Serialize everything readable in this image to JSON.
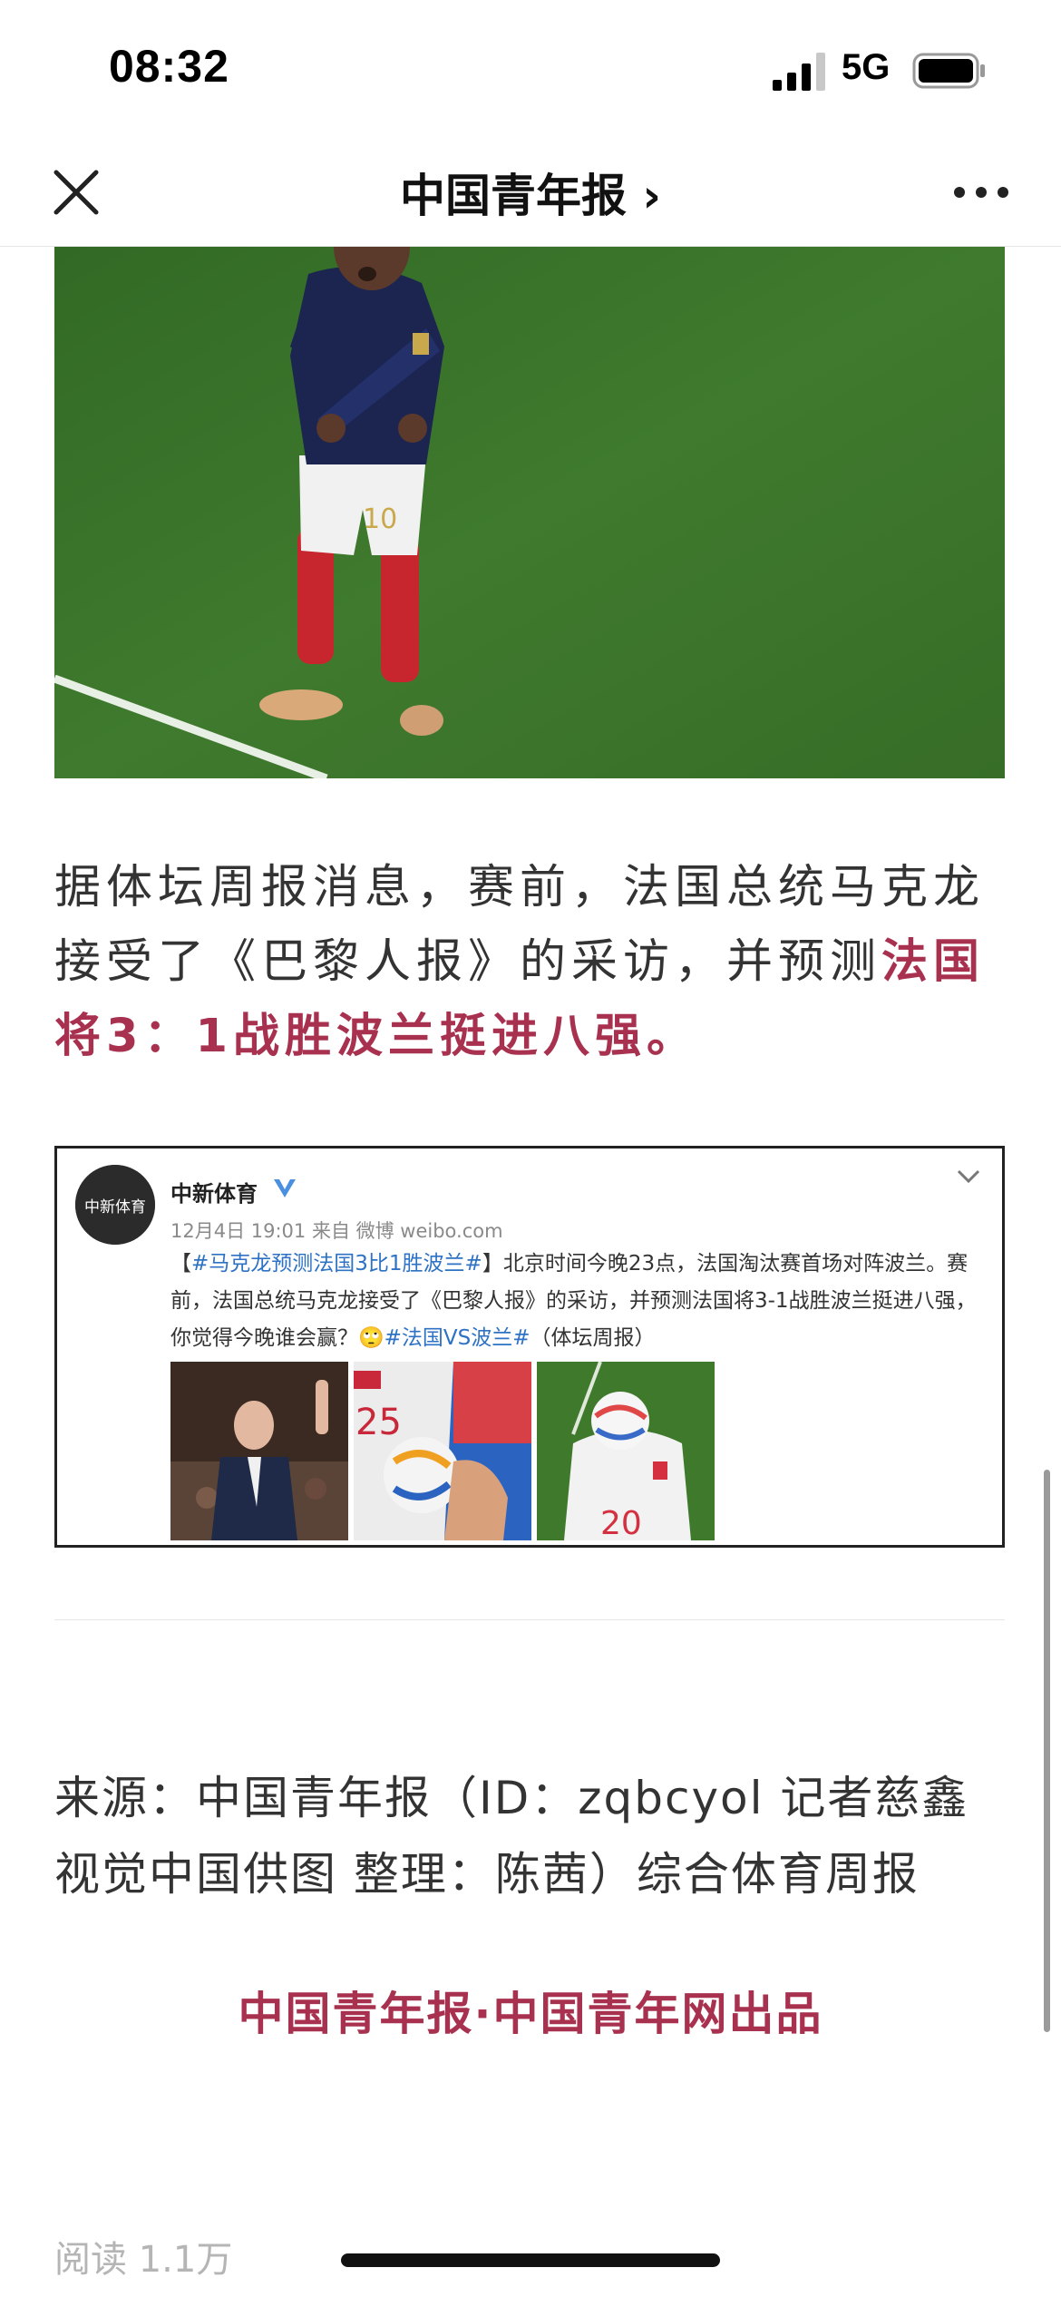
{
  "status_bar": {
    "time": "08:32",
    "network": "5G"
  },
  "nav": {
    "title": "中国青年报 ›"
  },
  "article": {
    "paragraph_plain": "据体坛周报消息，赛前，法国总统马克龙接受了《巴黎人报》的采访，并预测",
    "paragraph_highlight": "法国将3：1战胜波兰挺进八强。",
    "embed": {
      "account_name": "中新体育",
      "avatar_text": "中新体育",
      "meta": "12月4日 19:01 来自 微博 weibo.com",
      "text_bracket_open": "【",
      "text_tag1": "#马克龙预测法国3比1胜波兰#",
      "text_body": "】北京时间今晚23点，法国淘汰赛首场对阵波兰。赛前，法国总统马克龙接受了《巴黎人报》的采访，并预测法国将3-1战胜波兰挺进八强，你觉得今晚谁会赢？🙄",
      "text_tag2": "#法国VS波兰#",
      "text_suffix": "（体坛周报）",
      "photo2_number": "25",
      "photo3_number": "20"
    },
    "source": "来源：中国青年报（ID：zqbcyol 记者慈鑫 视觉中国供图 整理：陈茜）综合体育周报",
    "brand_line": "中国青年报·中国青年网出品",
    "read_count": "阅读 1.1万"
  },
  "colors": {
    "accent": "#a8314f",
    "link": "#2d72c4",
    "pitch": "#3f7d2e"
  },
  "icons": [
    "close-icon",
    "more-icon",
    "signal-icon",
    "battery-icon",
    "verified-icon",
    "chevron-down-icon"
  ]
}
